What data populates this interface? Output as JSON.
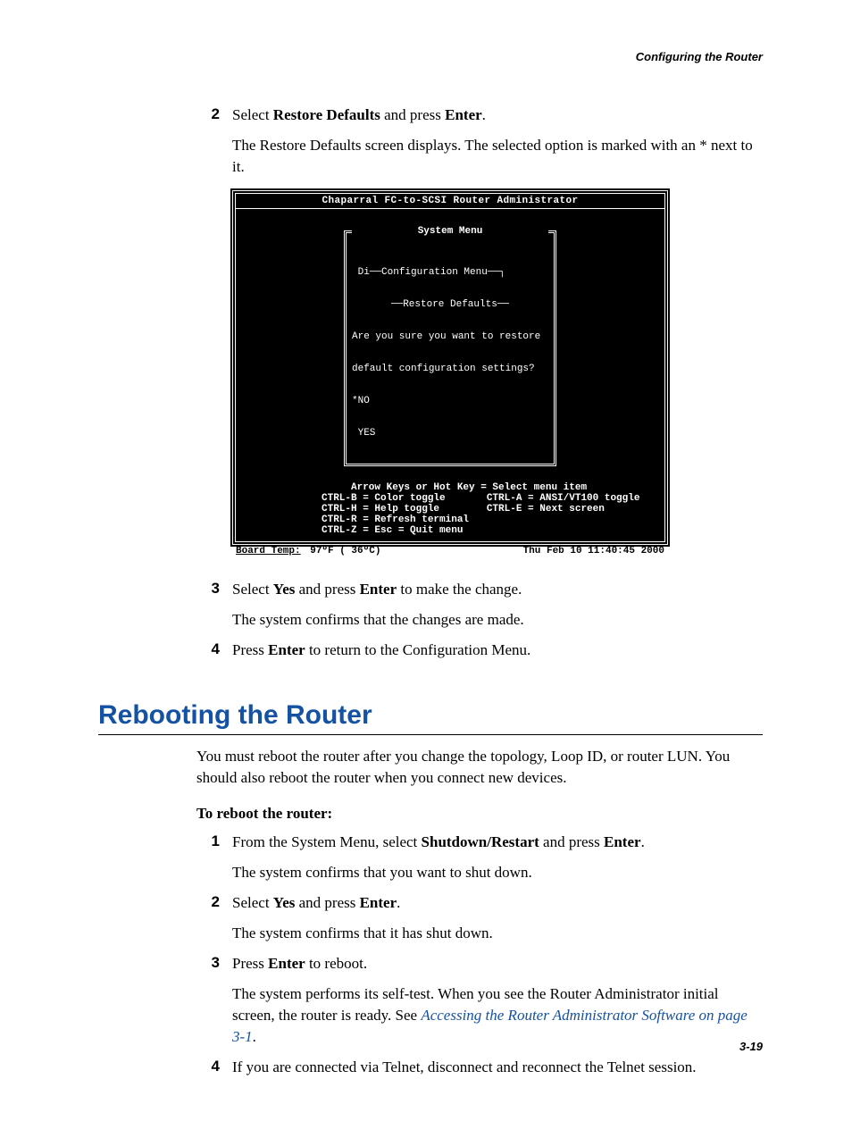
{
  "header": {
    "running": "Configuring the Router"
  },
  "sectionA": {
    "steps": {
      "s2": {
        "num": "2",
        "line1_a": "Select ",
        "line1_b": "Restore Defaults",
        "line1_c": " and press ",
        "line1_d": "Enter",
        "line1_e": ".",
        "line2": "The Restore Defaults screen displays. The selected option is marked with an * next to it."
      },
      "s3": {
        "num": "3",
        "a": "Select ",
        "b": "Yes",
        "c": " and press ",
        "d": "Enter",
        "e": " to make the change.",
        "f": "The system confirms that the changes are made."
      },
      "s4": {
        "num": "4",
        "a": "Press ",
        "b": "Enter",
        "c": " to return to the Configuration Menu."
      }
    }
  },
  "terminal": {
    "title": "Chaparral FC-to-SCSI Router Administrator",
    "menu_system": "System Menu",
    "menu_line_di": " Di",
    "menu_config": "Configuration Menu",
    "menu_restore": "Restore Defaults",
    "prompt1": "Are you sure you want to restore",
    "prompt2": "default configuration settings?",
    "opt_no": "*NO",
    "opt_yes": " YES",
    "hints": "     Arrow Keys or Hot Key = Select menu item\nCTRL-B = Color toggle       CTRL-A = ANSI/VT100 toggle\nCTRL-H = Help toggle        CTRL-E = Next screen\nCTRL-R = Refresh terminal\nCTRL-Z = Esc = Quit menu",
    "status_label": "Board Temp:",
    "status_val": "  97ºF ( 36ºC)",
    "status_time": "Thu Feb 10 11:40:45 2000"
  },
  "sectionB": {
    "title": "Rebooting the Router",
    "intro": "You must reboot the router after you change the topology, Loop ID, or router LUN. You should also reboot the router when you connect new devices.",
    "subhead": "To reboot the router:",
    "steps": {
      "s1": {
        "num": "1",
        "a": "From the System Menu, select ",
        "b": "Shutdown/Restart",
        "c": " and press ",
        "d": "Enter",
        "e": ".",
        "f": "The system confirms that you want to shut down."
      },
      "s2": {
        "num": "2",
        "a": "Select ",
        "b": "Yes",
        "c": " and press ",
        "d": "Enter",
        "e": ".",
        "f": "The system confirms that it has shut down."
      },
      "s3": {
        "num": "3",
        "a": "Press ",
        "b": "Enter",
        "c": " to reboot.",
        "f1": "The system performs its self-test. When you see the Router Administrator initial screen, the router is ready. See ",
        "link": "Accessing the Router Administrator Software on page 3-1",
        "f2": "."
      },
      "s4": {
        "num": "4",
        "a": "If you are connected via Telnet, disconnect and reconnect the Telnet session."
      }
    }
  },
  "footer": {
    "pagenum": "3-19"
  }
}
